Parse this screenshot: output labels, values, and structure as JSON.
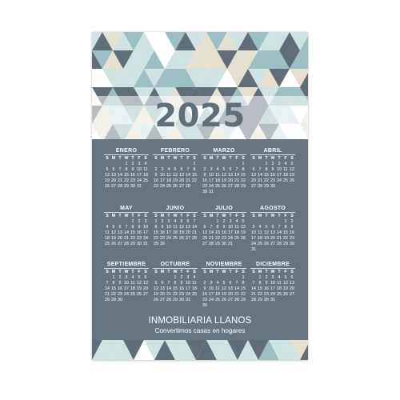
{
  "year": "2025",
  "company": "INMOBILIARIA LLANOS",
  "tagline": "Convertimos casas en hogares",
  "weekday_headers": [
    "S",
    "M",
    "T",
    "W",
    "T",
    "F",
    "S"
  ],
  "months": [
    {
      "name": "ENERO",
      "first_weekday": 3,
      "days": 31
    },
    {
      "name": "FEBRERO",
      "first_weekday": 6,
      "days": 28
    },
    {
      "name": "MARZO",
      "first_weekday": 6,
      "days": 31
    },
    {
      "name": "ABRIL",
      "first_weekday": 2,
      "days": 30
    },
    {
      "name": "MAY",
      "first_weekday": 4,
      "days": 31
    },
    {
      "name": "JUNIO",
      "first_weekday": 0,
      "days": 30
    },
    {
      "name": "JULIO",
      "first_weekday": 2,
      "days": 31
    },
    {
      "name": "AGOSTO",
      "first_weekday": 5,
      "days": 31
    },
    {
      "name": "SEPTIEMBRE",
      "first_weekday": 1,
      "days": 30
    },
    {
      "name": "OCTUBRE",
      "first_weekday": 3,
      "days": 31
    },
    {
      "name": "NOVIEMBRE",
      "first_weekday": 6,
      "days": 30
    },
    {
      "name": "DICIEMBRE",
      "first_weekday": 1,
      "days": 31
    }
  ],
  "colors": {
    "panel": "#66757f",
    "slate": "#5f6e78",
    "teal": "#9bbfc2",
    "pale_teal": "#cfe3e2",
    "beige": "#e6e0cf",
    "white": "#ffffff"
  }
}
